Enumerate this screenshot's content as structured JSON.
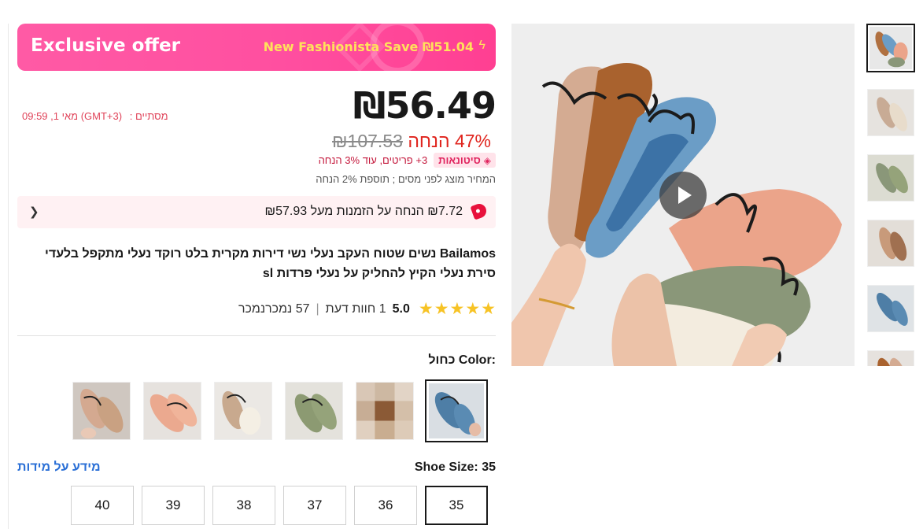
{
  "banner": {
    "label": "Exclusive offer",
    "save_text": "New Fashionista Save ₪51.04",
    "bolt_icon": "lightning-icon"
  },
  "price": {
    "current": "₪56.49",
    "original": "₪107.53",
    "discount": "47% הנחה",
    "ends_label": "מסתיים :",
    "ends_value": "מאי 1, 09:59 (GMT+3)",
    "bulk_badge": "סיטונאות",
    "bulk_text": "3+ פריטים, עוד 3% הנחה",
    "tax_note": "המחיר מוצג לפני מסים ; תוספת 2% הנחה"
  },
  "coupon": {
    "text": "₪7.72 הנחה על הזמנות מעל ₪57.93"
  },
  "product": {
    "title": "Bailamos נשים שטוח העקב נעלי נשי דירות מקרית בלט רוקד נעלי מתקפל בלעדי סירת נעלי הקיץ להחליק על נעלי פרדות sl"
  },
  "rating": {
    "stars": 5,
    "score": "5.0",
    "reviews": "1 חוות דעת",
    "sold": "57 נמכרנמכר"
  },
  "color": {
    "label": "Color:",
    "value": "כחול",
    "swatches": [
      {
        "name": "blue",
        "selected": true
      },
      {
        "name": "pattern",
        "selected": false
      },
      {
        "name": "green",
        "selected": false
      },
      {
        "name": "cream",
        "selected": false
      },
      {
        "name": "pink",
        "selected": false
      },
      {
        "name": "beige",
        "selected": false
      }
    ]
  },
  "size": {
    "label": "Shoe Size:",
    "value": "35",
    "info_link": "מידע על מידות",
    "options": [
      "35",
      "36",
      "37",
      "38",
      "39",
      "40"
    ],
    "selected": "35"
  },
  "gallery": {
    "thumb_count": 6,
    "play_icon": "play-icon"
  }
}
